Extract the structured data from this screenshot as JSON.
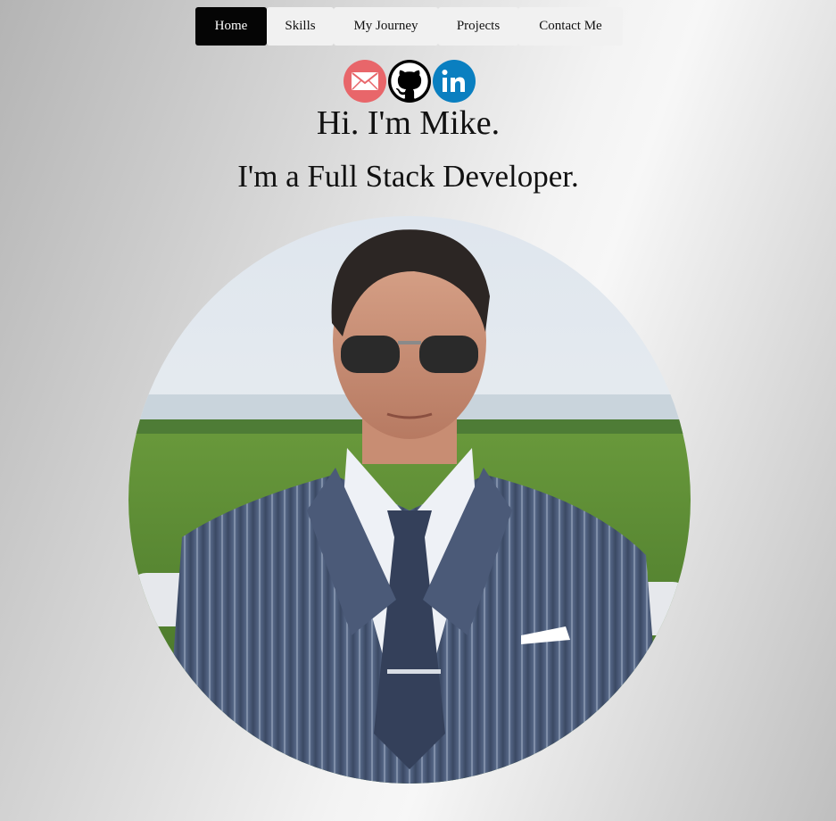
{
  "nav": {
    "items": [
      {
        "label": "Home",
        "active": true
      },
      {
        "label": "Skills",
        "active": false
      },
      {
        "label": "My Journey",
        "active": false
      },
      {
        "label": "Projects",
        "active": false
      },
      {
        "label": "Contact Me",
        "active": false
      }
    ]
  },
  "socials": [
    {
      "icon": "email-icon",
      "color": "#e8666a"
    },
    {
      "icon": "github-icon",
      "color": "#000000"
    },
    {
      "icon": "linkedin-icon",
      "color": "#0a7fc0"
    }
  ],
  "hero": {
    "greeting": "Hi. I'm Mike.",
    "tagline": "I'm a Full Stack Developer."
  },
  "colors": {
    "nav_active_bg": "#050505",
    "nav_bg": "#f1f1f1"
  }
}
